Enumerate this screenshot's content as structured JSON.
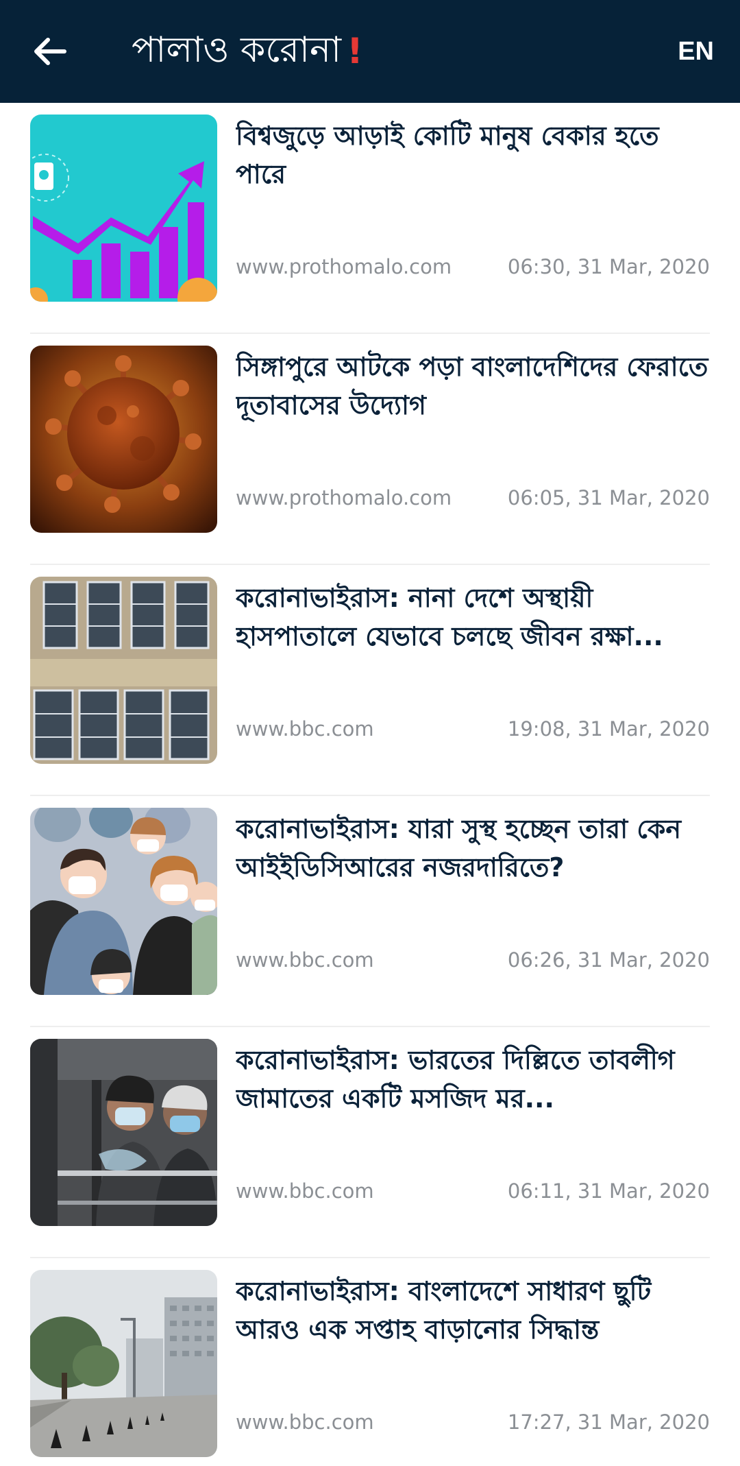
{
  "header": {
    "title": "পালাও করোনা",
    "title_mark": "!",
    "language_label": "EN",
    "back_icon": "arrow-left-icon"
  },
  "colors": {
    "header_bg": "#062238",
    "headline": "#0b2239",
    "meta": "#8b8f94",
    "accent_mark": "#e53935"
  },
  "news": [
    {
      "headline": "বিশ্বজুড়ে আড়াই কোটি মানুষ বেকার হতে পারে",
      "source": "www.prothomalo.com",
      "time": "06:30, 31 Mar, 2020",
      "image": "chart-arrow-illustration"
    },
    {
      "headline": "সিঙ্গাপুরে আটকে পড়া বাংলাদেশিদের ফেরাতে দূতাবাসের উদ্যোগ",
      "source": "www.prothomalo.com",
      "time": "06:05, 31 Mar, 2020",
      "image": "coronavirus-particle"
    },
    {
      "headline": "করোনাভাইরাস: নানা দেশে অস্থায়ী হাসপাতালে যেভাবে চলছে জীবন রক্ষা...",
      "source": "www.bbc.com",
      "time": "19:08, 31 Mar, 2020",
      "image": "field-hospital-aerial"
    },
    {
      "headline": "করোনাভাইরাস: যারা সুস্থ হচ্ছেন তারা কেন আইইডিসিআরের নজরদারিতে?",
      "source": "www.bbc.com",
      "time": "06:26, 31 Mar, 2020",
      "image": "masked-crowd-illustration"
    },
    {
      "headline": "করোনাভাইরাস: ভারতের দিল্লিতে তাবলীগ জামাতের একটি মসজিদ মর...",
      "source": "www.bbc.com",
      "time": "06:11, 31 Mar, 2020",
      "image": "bus-passengers-masks"
    },
    {
      "headline": "করোনাভাইরাস: বাংলাদেশে সাধারণ ছুটি আরও এক সপ্তাহ বাড়ানোর সিদ্ধান্ত",
      "source": "www.bbc.com",
      "time": "17:27, 31 Mar, 2020",
      "image": "empty-street-cones"
    }
  ]
}
